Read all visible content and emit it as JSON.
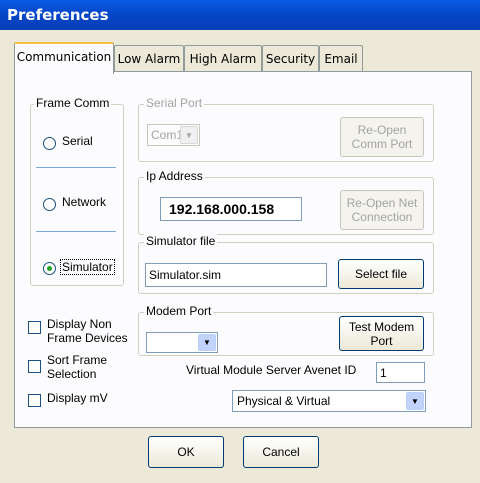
{
  "window": {
    "title": "Preferences"
  },
  "tabs": [
    "Communication",
    "Low Alarm",
    "High Alarm",
    "Security",
    "Email"
  ],
  "frame_comm": {
    "label": "Frame Comm",
    "serial_label": "Serial",
    "network_label": "Network",
    "simulator_label": "Simulator",
    "selected": "Simulator"
  },
  "serial_port": {
    "label": "Serial Port",
    "value": "Com1",
    "reopen_label": "Re-Open Comm Port"
  },
  "ip_address": {
    "label": "Ip Address",
    "value": "192.168.000.158",
    "reopen_label": "Re-Open Net Connection"
  },
  "simulator_file": {
    "label": "Simulator file",
    "value": "Simulator.sim",
    "select_label": "Select file"
  },
  "modem_port": {
    "label": "Modem Port",
    "value": "",
    "test_label": "Test Modem Port"
  },
  "options": {
    "display_non_frame": "Display Non Frame Devices",
    "sort_frame": "Sort Frame Selection",
    "display_mv": "Display mV"
  },
  "virtual_module": {
    "label": "Virtual Module Server Avenet ID",
    "value": "1",
    "mode_value": "Physical & Virtual"
  },
  "footer": {
    "ok_label": "OK",
    "cancel_label": "Cancel"
  }
}
